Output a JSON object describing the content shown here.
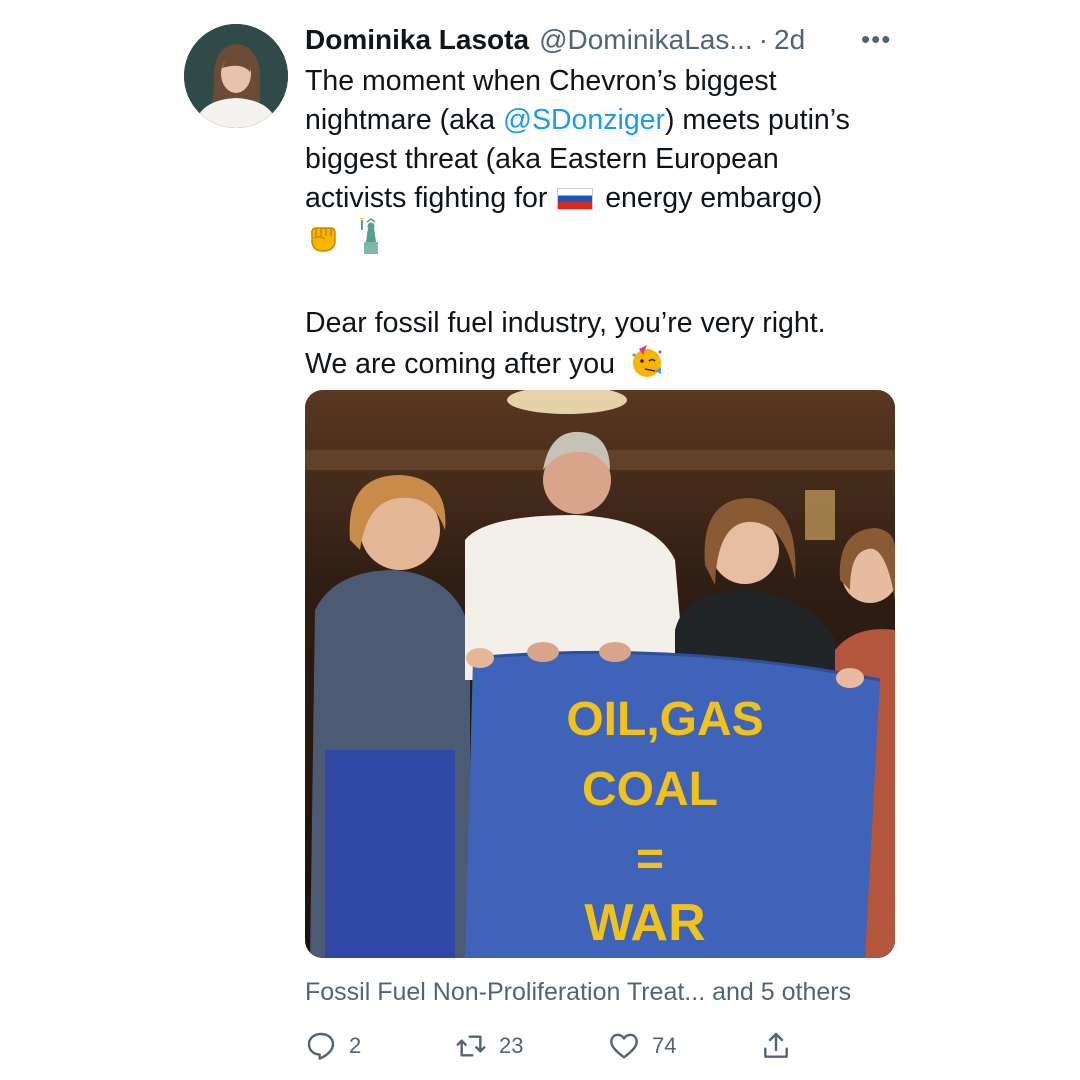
{
  "author": {
    "name": "Dominika Lasota",
    "handle": "@DominikaLas...",
    "separator": "·",
    "time": "2d",
    "more_icon": "more-dots-icon"
  },
  "tweet": {
    "line1": "The moment when Chevron’s biggest",
    "line2_a": "nightmare (aka ",
    "mention": "@SDonziger",
    "line2_b": ") meets putin’s",
    "line3": "biggest threat (aka Eastern European",
    "line4_a": "activists fighting for",
    "line4_b": "energy embargo)",
    "emojis_line": [
      "raised-fist-emoji",
      "statue-of-liberty-emoji"
    ],
    "line6": "Dear fossil fuel industry, you’re very right.",
    "line7": "We are coming after you",
    "party_emoji": "partying-face-emoji",
    "flag": "russia-flag-emoji"
  },
  "photo": {
    "banner_line1": "OIL,GAS",
    "banner_line2": "COAL",
    "banner_line3": "=",
    "banner_line4": "WAR",
    "banner_color": "#3f63b8",
    "text_color": "#f1c21b"
  },
  "community": {
    "label": "Fossil Fuel Non-Proliferation Treat... and 5 others"
  },
  "actions": {
    "replies": "2",
    "retweets": "23",
    "likes": "74"
  },
  "colors": {
    "text": "#0f1419",
    "secondary": "#536471",
    "link": "#1d9bf0"
  }
}
